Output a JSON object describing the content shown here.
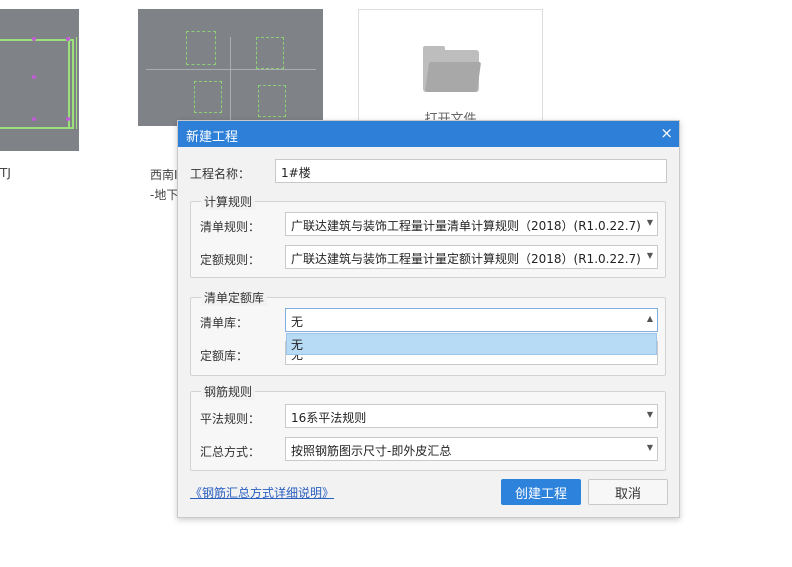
{
  "background": {
    "thumb1_caption": "TJ",
    "thumb2_caption_line1": "西南I",
    "thumb2_caption_line2": "-地下",
    "open_file_label": "打开文件"
  },
  "dialog": {
    "title": "新建工程",
    "close_glyph": "×",
    "project_name_label": "工程名称：",
    "project_name_value": "1#楼",
    "calc_rules": {
      "title": "计算规则",
      "bill_rule_label": "清单规则：",
      "bill_rule_value": "广联达建筑与装饰工程量计量清单计算规则（2018）(R1.0.22.7)",
      "quota_rule_label": "定额规则：",
      "quota_rule_value": "广联达建筑与装饰工程量计量定额计算规则（2018）(R1.0.22.7)"
    },
    "library": {
      "title": "清单定额库",
      "bill_lib_label": "清单库：",
      "bill_lib_value": "无",
      "quota_lib_label": "定额库：",
      "quota_lib_value": "无",
      "dropdown_options": [
        "无"
      ]
    },
    "rebar_rules": {
      "title": "钢筋规则",
      "flat_rule_label": "平法规则：",
      "flat_rule_value": "16系平法规则",
      "summary_label": "汇总方式：",
      "summary_value": "按照钢筋图示尺寸-即外皮汇总"
    },
    "help_link": "《钢筋汇总方式详细说明》",
    "create_label": "创建工程",
    "cancel_label": "取消"
  },
  "icons": {
    "select_arrow": "▼",
    "select_arrow_up": "▲"
  },
  "colors": {
    "titlebar": "#2d7fd8",
    "primary_button": "#2d82dc",
    "dropdown_highlight": "#b7dbf5",
    "link": "#2a5fc0"
  }
}
